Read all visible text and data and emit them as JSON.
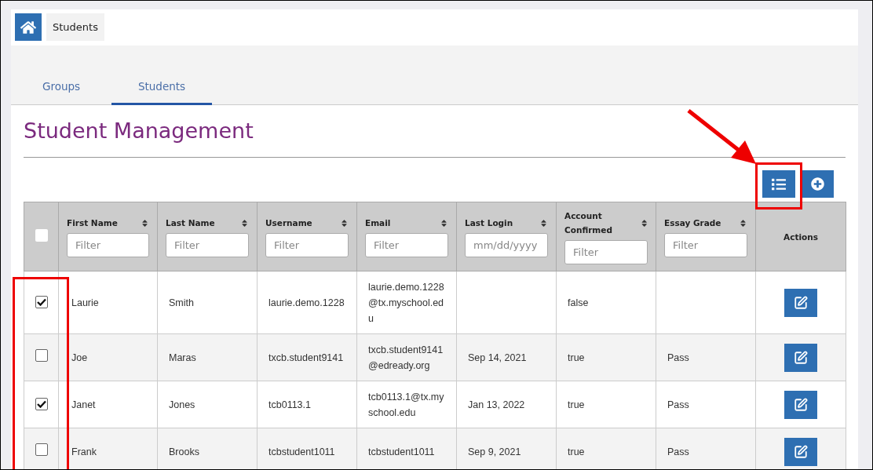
{
  "breadcrumb": [
    "Students"
  ],
  "tabs": [
    {
      "label": "Groups",
      "selected": false
    },
    {
      "label": "Students",
      "selected": true
    }
  ],
  "title": "Student Management",
  "table": {
    "select_all": {
      "checked": false
    },
    "columns": [
      {
        "label": "First Name",
        "sortable": true,
        "placeholder": "Filter"
      },
      {
        "label": "Last Name",
        "sortable": true,
        "placeholder": "Filter"
      },
      {
        "label": "Username",
        "sortable": true,
        "placeholder": "Filter"
      },
      {
        "label": "Email",
        "sortable": true,
        "placeholder": "Filter"
      },
      {
        "label": "Last Login",
        "sortable": true,
        "placeholder": "mm/dd/yyyy"
      },
      {
        "label": "Account Confirmed",
        "sortable": true,
        "placeholder": "Filter"
      },
      {
        "label": "Essay Grade",
        "sortable": true,
        "placeholder": "Filter"
      },
      {
        "label": "Actions"
      }
    ],
    "rows": [
      {
        "selected": true,
        "first_name": "Laurie",
        "last_name": "Smith",
        "username": "laurie.demo.1228",
        "email": "laurie.demo.1228@tx.myschool.edu",
        "account_confirmed": "false"
      },
      {
        "selected": false,
        "first_name": "Joe",
        "last_name": "Maras",
        "username": "txcb.student9141",
        "email": "txcb.student9141@edready.org",
        "last_login": "Sep 14, 2021",
        "account_confirmed": "true",
        "essay_grade": "Pass"
      },
      {
        "selected": true,
        "first_name": "Janet",
        "last_name": "Jones",
        "username": "tcb0113.1",
        "email": "tcb0113.1@tx.myschool.edu",
        "last_login": "Jan 13, 2022",
        "account_confirmed": "true",
        "essay_grade": "Pass"
      },
      {
        "selected": false,
        "first_name": "Frank",
        "last_name": "Brooks",
        "username": "tcbstudent1011",
        "email": "tcbstudent1011",
        "last_login": "Sep 9, 2021",
        "account_confirmed": "true",
        "essay_grade": "Pass"
      }
    ]
  }
}
